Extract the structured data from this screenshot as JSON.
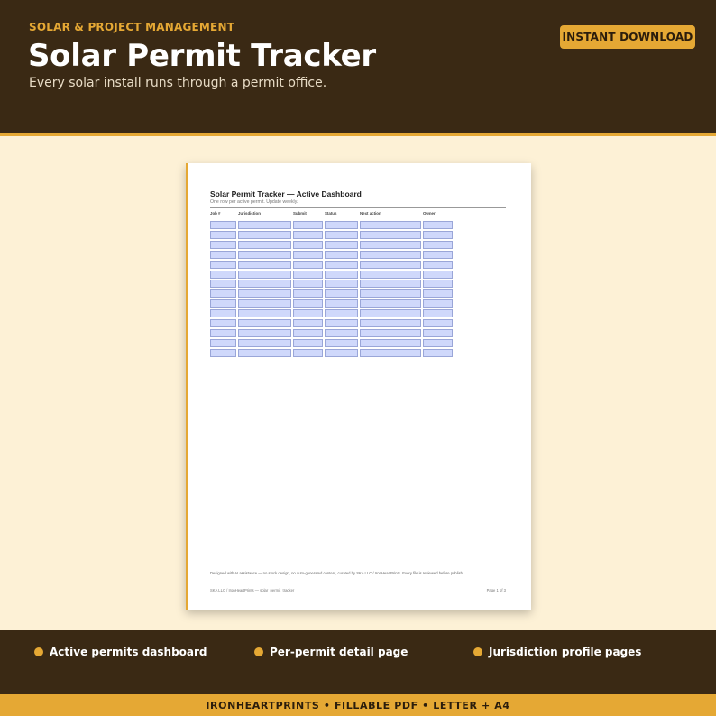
{
  "header": {
    "category": "SOLAR & PROJECT MANAGEMENT",
    "title": "Solar Permit Tracker",
    "subtitle": "Every solar install runs through a permit office.",
    "download_label": "INSTANT DOWNLOAD"
  },
  "document": {
    "title": "Solar Permit Tracker — Active Dashboard",
    "subtitle": "One row per active permit. Update weekly.",
    "columns": [
      "Job #",
      "Jurisdiction",
      "Submit",
      "Status",
      "Next action",
      "Owner"
    ],
    "row_count": 14,
    "note": "Designed with AI assistance — no stock design, no auto-generated content, curated by SKA LLC / IronHeartPrints. Every file is reviewed before publish.",
    "footer_left": "SKA LLC / IronHeartPrints — solar_permit_tracker",
    "footer_right": "Page 1 of 3"
  },
  "features": [
    "Active permits dashboard",
    "Per-permit detail page",
    "Jurisdiction profile pages"
  ],
  "bottom_bar": "IRONHEARTPRINTS  •  FILLABLE PDF  •  LETTER + A4",
  "colors": {
    "dark": "#3a2914",
    "accent": "#e5a834",
    "cream": "#fdf1d6",
    "field": "#cfd8fb"
  }
}
